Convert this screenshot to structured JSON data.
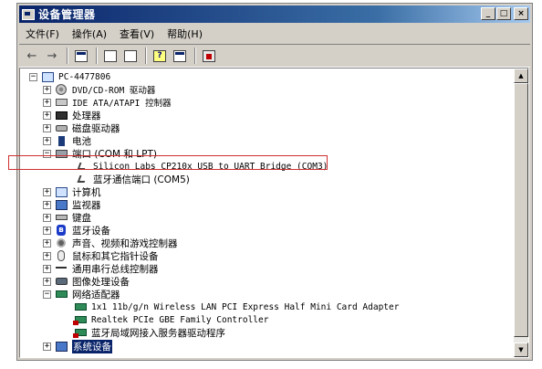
{
  "window": {
    "title": "设备管理器"
  },
  "window_buttons": {
    "minimize": "_",
    "maximize": "□",
    "close": "×"
  },
  "menu": [
    {
      "label": "文件(F)"
    },
    {
      "label": "操作(A)"
    },
    {
      "label": "查看(V)"
    },
    {
      "label": "帮助(H)"
    }
  ],
  "toolbar": {
    "back": "←",
    "forward": "→",
    "help": "?"
  },
  "tree": {
    "root": "PC-4477806",
    "items": [
      {
        "label": "DVD/CD-ROM 驱动器",
        "icon": "disk-icon"
      },
      {
        "label": "IDE ATA/ATAPI 控制器",
        "icon": "drive-icon"
      },
      {
        "label": "处理器",
        "icon": "chip-icon"
      },
      {
        "label": "磁盘驱动器",
        "icon": "disk-drive-icon"
      },
      {
        "label": "电池",
        "icon": "battery-icon"
      },
      {
        "label": "端口 (COM 和 LPT)",
        "icon": "port-icon",
        "expanded": true,
        "children": [
          {
            "label": "Silicon Labs CP210x USB to UART Bridge (COM3)",
            "icon": "cable-icon"
          },
          {
            "label": "蓝牙通信端口 (COM5)",
            "icon": "cable-icon"
          }
        ]
      },
      {
        "label": "计算机",
        "icon": "computer-icon"
      },
      {
        "label": "监视器",
        "icon": "monitor-icon"
      },
      {
        "label": "键盘",
        "icon": "keyboard-icon"
      },
      {
        "label": "蓝牙设备",
        "icon": "bluetooth-icon"
      },
      {
        "label": "声音、视频和游戏控制器",
        "icon": "speaker-icon"
      },
      {
        "label": "鼠标和其它指针设备",
        "icon": "mouse-icon"
      },
      {
        "label": "通用串行总线控制器",
        "icon": "usb-icon"
      },
      {
        "label": "图像处理设备",
        "icon": "imaging-icon"
      },
      {
        "label": "网络适配器",
        "icon": "network-icon",
        "expanded": true,
        "children": [
          {
            "label": "1x1 11b/g/n Wireless LAN PCI Express Half Mini Card Adapter",
            "icon": "network-card-icon"
          },
          {
            "label": "Realtek PCIe GBE Family Controller",
            "icon": "network-card-icon"
          },
          {
            "label": "蓝牙局域网接入服务器驱动程序",
            "icon": "network-card-icon"
          }
        ]
      },
      {
        "label": "系统设备",
        "icon": "system-icon",
        "selected": true
      }
    ]
  },
  "tree_glyphs": {
    "collapsed": "+",
    "expanded": "−"
  },
  "scroll": {
    "up": "▲",
    "down": "▼"
  },
  "colors": {
    "titlebar": "#0a246a",
    "highlight_box": "#d03030",
    "selection": "#0a246a"
  },
  "bluetooth_glyph": "ʙ"
}
